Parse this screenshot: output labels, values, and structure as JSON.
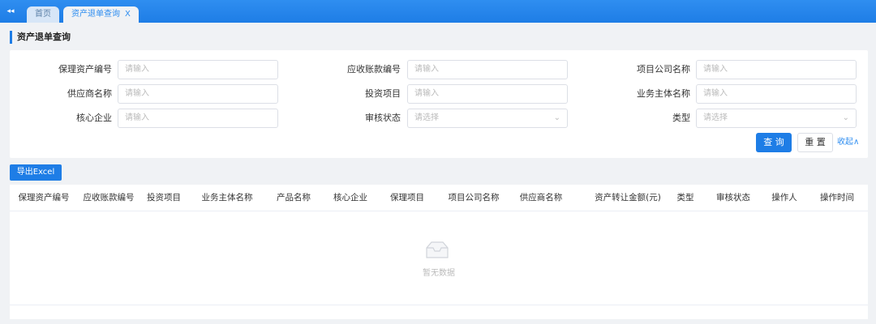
{
  "tabs": [
    {
      "label": "首页"
    },
    {
      "label": "资产退单查询",
      "close": "X"
    }
  ],
  "page_title": "资产退单查询",
  "filters": [
    [
      {
        "label": "保理资产编号",
        "placeholder": "请输入"
      },
      {
        "label": "应收账款编号",
        "placeholder": "请输入"
      },
      {
        "label": "项目公司名称",
        "placeholder": "请输入"
      }
    ],
    [
      {
        "label": "供应商名称",
        "placeholder": "请输入"
      },
      {
        "label": "投资项目",
        "placeholder": "请输入"
      },
      {
        "label": "业务主体名称",
        "placeholder": "请输入"
      }
    ],
    [
      {
        "label": "核心企业",
        "placeholder": "请输入"
      },
      {
        "label": "审核状态",
        "placeholder": "请选择"
      },
      {
        "label": "类型",
        "placeholder": "请选择"
      }
    ]
  ],
  "buttons": {
    "query": "查 询",
    "reset": "重 置",
    "collapse": "收起∧",
    "export": "导出Excel"
  },
  "table": {
    "columns": [
      "保理资产编号",
      "应收账款编号",
      "投资项目",
      "业务主体名称",
      "产品名称",
      "核心企业",
      "保理项目",
      "项目公司名称",
      "供应商名称",
      "资产转让金额(元)",
      "类型",
      "审核状态",
      "操作人",
      "操作时间"
    ],
    "empty_text": "暂无数据"
  },
  "icons": {
    "collapse": "double-chevron-left-icon",
    "empty": "empty-inbox-icon",
    "select_arrow": "chevron-down-icon"
  },
  "colors": {
    "primary": "#1e7de6",
    "header_bar": "#2f8ef0"
  }
}
